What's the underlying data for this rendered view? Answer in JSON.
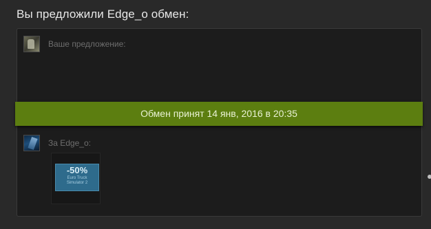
{
  "heading": "Вы предложили Edge_o обмен:",
  "offer": {
    "your_label": "Ваше предложение:",
    "their_label": "За Edge_o:"
  },
  "status_banner": "Обмен принят 14 янв, 2016 в 20:35",
  "items": [
    {
      "discount": "-50%",
      "title": "Euro Truck Simulator 2",
      "color": "#2e6b8c"
    }
  ],
  "colors": {
    "background": "#292929",
    "panel": "#1c1c1c",
    "accepted": "#5c7e10"
  }
}
